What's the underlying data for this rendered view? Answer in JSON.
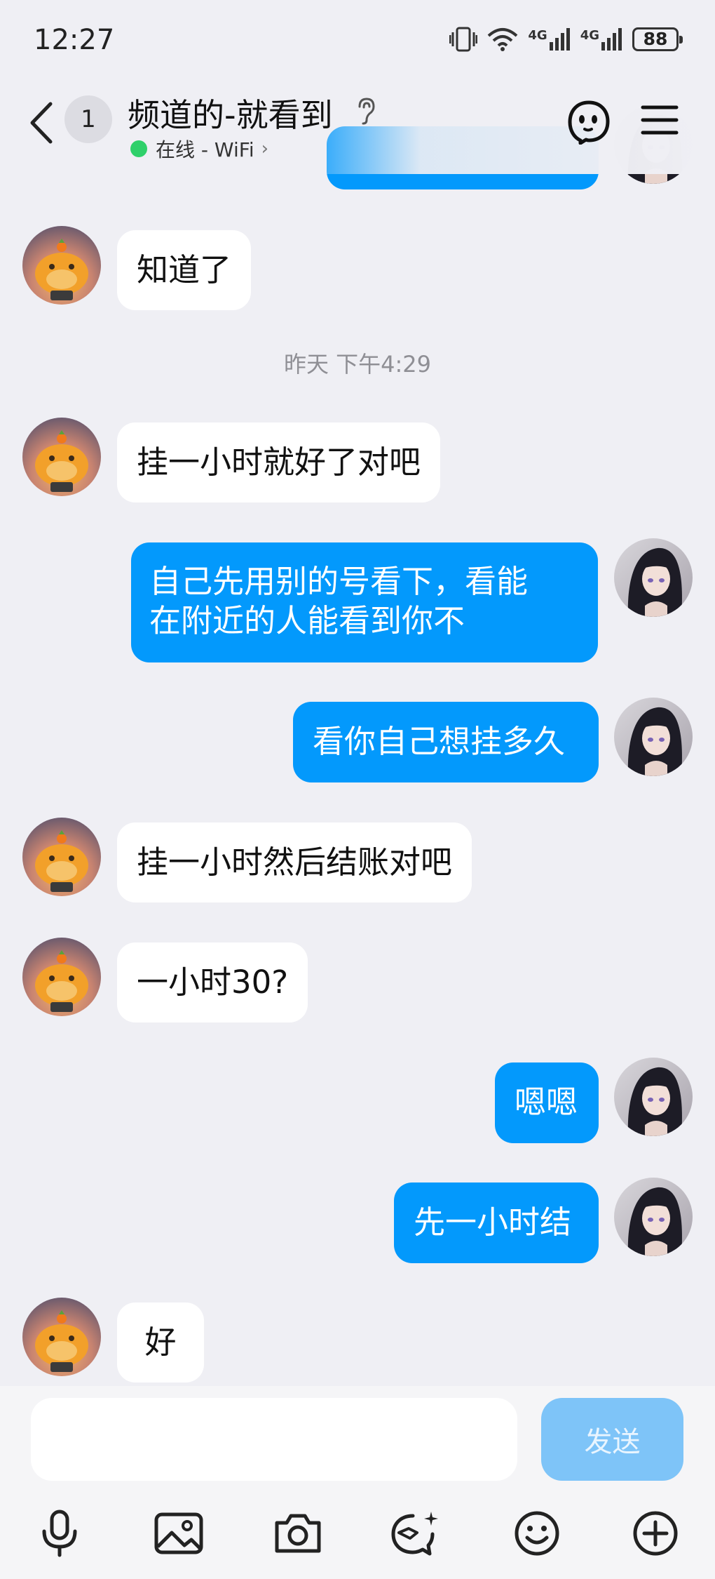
{
  "status_bar": {
    "time": "12:27",
    "battery": "88",
    "network_label_1": "4G",
    "network_label_2": "4G"
  },
  "header": {
    "unread_count": "1",
    "title": "频道的-就看到",
    "presence_status": "在线 - WiFi",
    "online_color": "#2fd06a"
  },
  "messages": [
    {
      "side": "out",
      "text": ""
    },
    {
      "side": "in",
      "text": "知道了"
    },
    {
      "side": "in",
      "text": "挂一小时就好了对吧"
    },
    {
      "side": "out",
      "text": "自己先用别的号看下，看能在附近的人能看到你不",
      "lines": [
        "自己先用别的号看下，看能",
        "在附近的人能看到你不"
      ]
    },
    {
      "side": "out",
      "text": "看你自己想挂多久"
    },
    {
      "side": "in",
      "text": "挂一小时然后结账对吧"
    },
    {
      "side": "in",
      "text": "一小时30?"
    },
    {
      "side": "out",
      "text": "嗯嗯"
    },
    {
      "side": "out",
      "text": "先一小时结"
    },
    {
      "side": "in",
      "text": "好"
    }
  ],
  "time_separator": "昨天 下午4:29",
  "composer": {
    "input_value": "",
    "send_label": "发送"
  },
  "toolbar": {
    "icons": [
      "microphone-icon",
      "image-icon",
      "camera-icon",
      "sticker-icon",
      "emoji-icon",
      "plus-icon"
    ]
  },
  "colors": {
    "background": "#efeff4",
    "outgoing_bubble": "#0399fc",
    "incoming_bubble": "#ffffff",
    "send_button_disabled": "#7ec4f8"
  }
}
